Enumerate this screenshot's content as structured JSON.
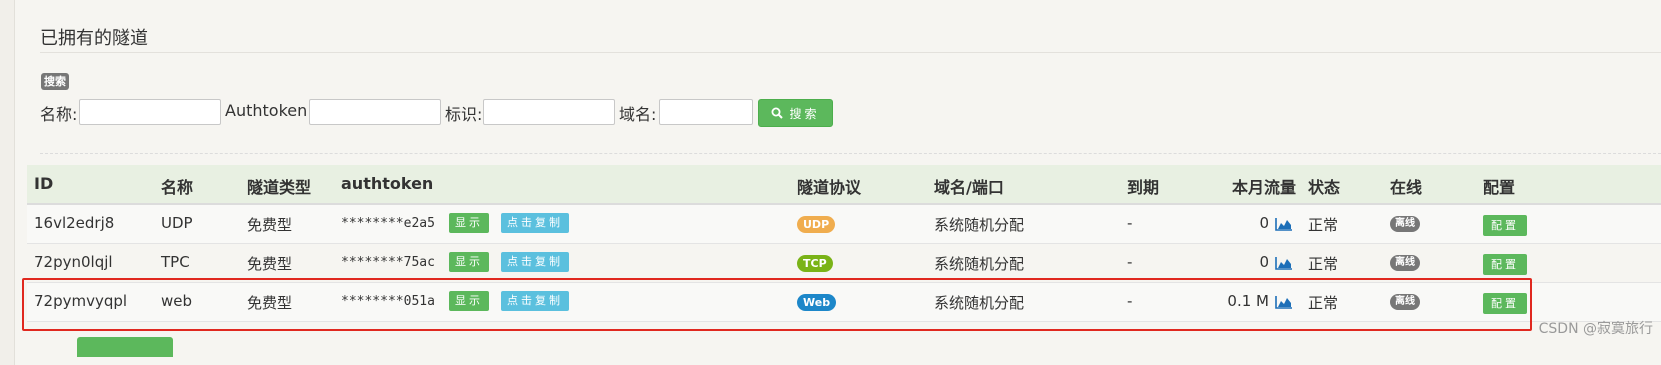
{
  "panel": {
    "title": "已拥有的隧道"
  },
  "search": {
    "badge": "搜索",
    "name_label": "名称:",
    "name_value": "",
    "authtoken_label": "Authtoken:",
    "authtoken_value": "",
    "tag_label": "标识:",
    "tag_value": "",
    "domain_label": "域名:",
    "domain_value": "",
    "button_label": "搜索"
  },
  "table": {
    "headers": {
      "id": "ID",
      "name": "名称",
      "type": "隧道类型",
      "authtoken": "authtoken",
      "protocol": "隧道协议",
      "domain_port": "域名/端口",
      "expire": "到期",
      "traffic": "本月流量",
      "status": "状态",
      "online": "在线",
      "config": "配置"
    },
    "rows": [
      {
        "id": "16vl2edrj8",
        "name": "UDP",
        "type": "免费型",
        "authtoken": "********e2a5",
        "show_label": "显示",
        "copy_label": "点击复制",
        "protocol": "UDP",
        "domain": "系统随机分配",
        "expire": "-",
        "traffic": "0",
        "status": "正常",
        "online": "离线",
        "config_label": "配置"
      },
      {
        "id": "72pyn0lqjl",
        "name": "TPC",
        "type": "免费型",
        "authtoken": "********75ac",
        "show_label": "显示",
        "copy_label": "点击复制",
        "protocol": "TCP",
        "domain": "系统随机分配",
        "expire": "-",
        "traffic": "0",
        "status": "正常",
        "online": "离线",
        "config_label": "配置"
      },
      {
        "id": "72pymvyqpl",
        "name": "web",
        "type": "免费型",
        "authtoken": "********051a",
        "show_label": "显示",
        "copy_label": "点击复制",
        "protocol": "Web",
        "domain": "系统随机分配",
        "expire": "-",
        "traffic": "0.1 M",
        "status": "正常",
        "online": "离线",
        "config_label": "配置"
      }
    ]
  },
  "watermark": "CSDN @寂寞旅行",
  "colors": {
    "success": "#5cb85c",
    "info": "#5bc0de",
    "udp": "#f0ad4e",
    "tcp": "#7ab317",
    "web": "#1d87c9",
    "offline": "#777777",
    "highlight": "#e0281f"
  },
  "icons": {
    "search": "magnifier-icon",
    "traffic_chart": "area-chart-icon"
  }
}
